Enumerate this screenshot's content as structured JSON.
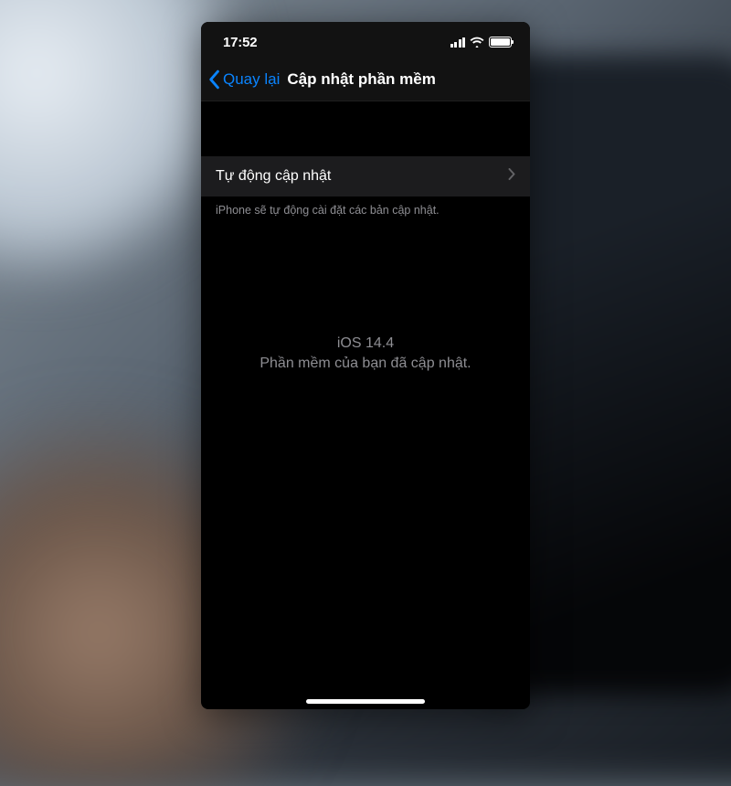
{
  "statusBar": {
    "time": "17:52"
  },
  "navBar": {
    "backLabel": "Quay lại",
    "title": "Cập nhật phần mềm"
  },
  "cell": {
    "label": "Tự động cập nhật"
  },
  "footerNote": "iPhone sẽ tự động cài đặt các bản cập nhật.",
  "center": {
    "version": "iOS 14.4",
    "status": "Phần mềm của bạn đã cập nhật."
  }
}
